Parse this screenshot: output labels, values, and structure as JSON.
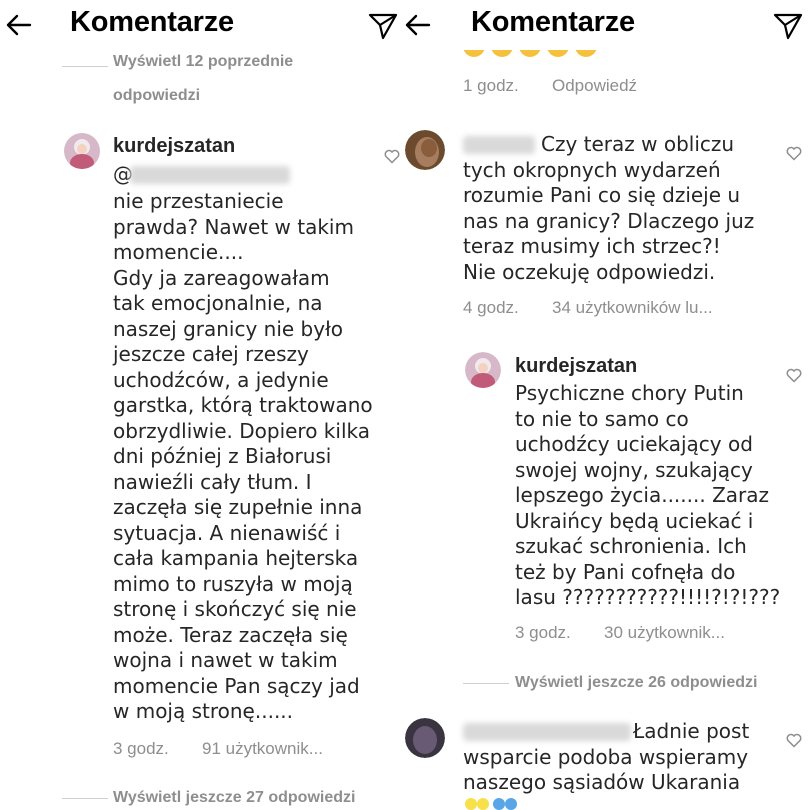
{
  "left": {
    "header": {
      "title": "Komentarze"
    },
    "top_view_replies": {
      "line1": "Wyświetl 12 poprzednie",
      "line2": "odpowiedzi"
    },
    "comment": {
      "username": "kurdejszatan",
      "mention_prefix": "@",
      "text": "nie przestaniecie\nprawda? Nawet w takim\nmomencie....\nGdy ja zareagowałam\ntak emocjonalnie, na\nnaszej granicy nie było\njeszcze całej rzeszy\nuchodźców, a jedynie\ngarstka, którą traktowano\nobrzydliwie. Dopiero kilka\ndni później z Białorusi\nnawieźli cały tłum. I\nzaczęła się zupełnie inna\nsytuacja. A nienawiść i\ncała kampania hejterska\nmimo to ruszyła w moją\nstronę i skończyć się nie\nmoże. Teraz zaczęła się\nwojna i nawet w takim\nmomencie Pan sączy jad\nw moją stronę......",
      "time": "3 godz.",
      "likes": "91 użytkownik..."
    },
    "bottom_view_replies": "Wyświetl jeszcze 27 odpowiedzi"
  },
  "right": {
    "header": {
      "title": "Komentarze"
    },
    "top_meta": {
      "time": "1 godz.",
      "reply": "Odpowiedź"
    },
    "comment1": {
      "text": "Czy teraz w obliczu\ntych okropnych wydarzeń\nrozumie Pani co się dzieje u\nnas na granicy? Dlaczego juz\nteraz musimy ich strzec?!\nNie oczekuję odpowiedzi.",
      "time": "4 godz.",
      "likes": "34 użytkowników lu..."
    },
    "reply": {
      "username": "kurdejszatan",
      "text": "Psychiczne chory Putin\nto nie to samo co\nuchodźcy uciekający od\nswojej wojny, szukający\nlepszego życia....... Zaraz\nUkraińcy będą uciekać i\nszukać schronienia. Ich\nteż by Pani cofnęła do\nlasu ???????????!!!!?!?!???",
      "time": "3 godz.",
      "likes": "30 użytkownik..."
    },
    "view_replies": "Wyświetl jeszcze 26 odpowiedzi",
    "comment2": {
      "text": "Ładnie post\nwsparcie podoba wspieramy\nnaszego sąsiadów Ukarania"
    }
  }
}
